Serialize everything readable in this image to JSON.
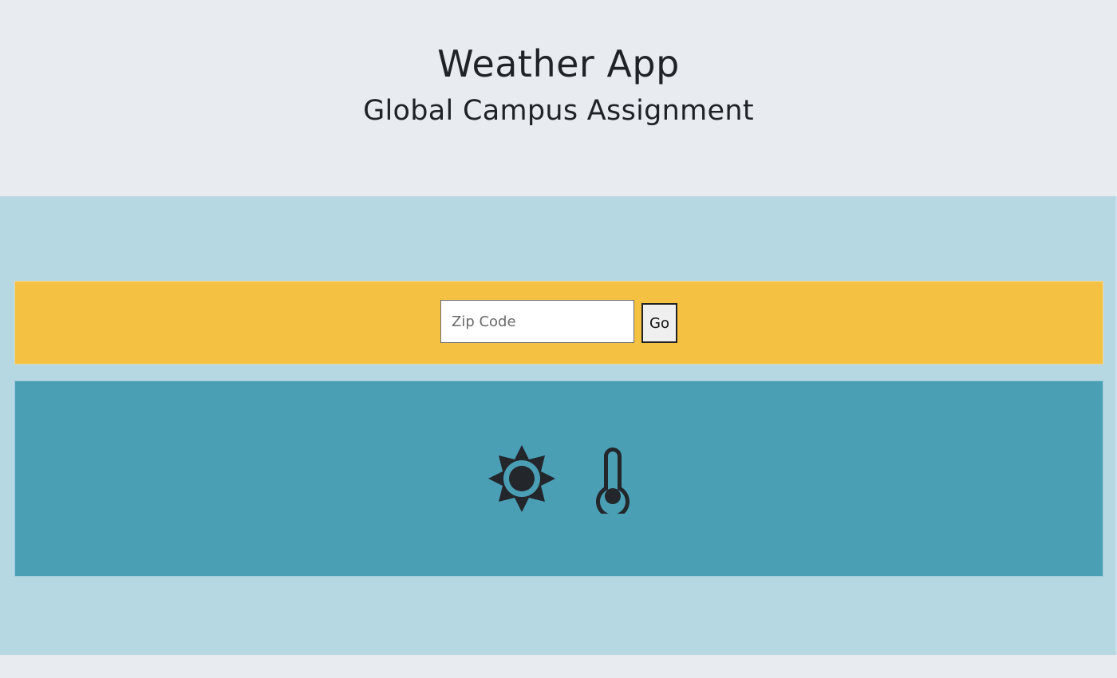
{
  "header": {
    "title": "Weather App",
    "subtitle": "Global Campus Assignment"
  },
  "search": {
    "placeholder": "Zip Code",
    "value": "",
    "button_label": "Go"
  },
  "weather": {
    "condition_icon": "sun-icon",
    "temperature_icon": "thermometer-icon"
  },
  "colors": {
    "header_bg": "#e8ecf0",
    "main_bg": "#b6d8e3",
    "search_bar_bg": "#f5c143",
    "weather_panel_bg": "#4a9fb5",
    "icon_color": "#23262b"
  }
}
